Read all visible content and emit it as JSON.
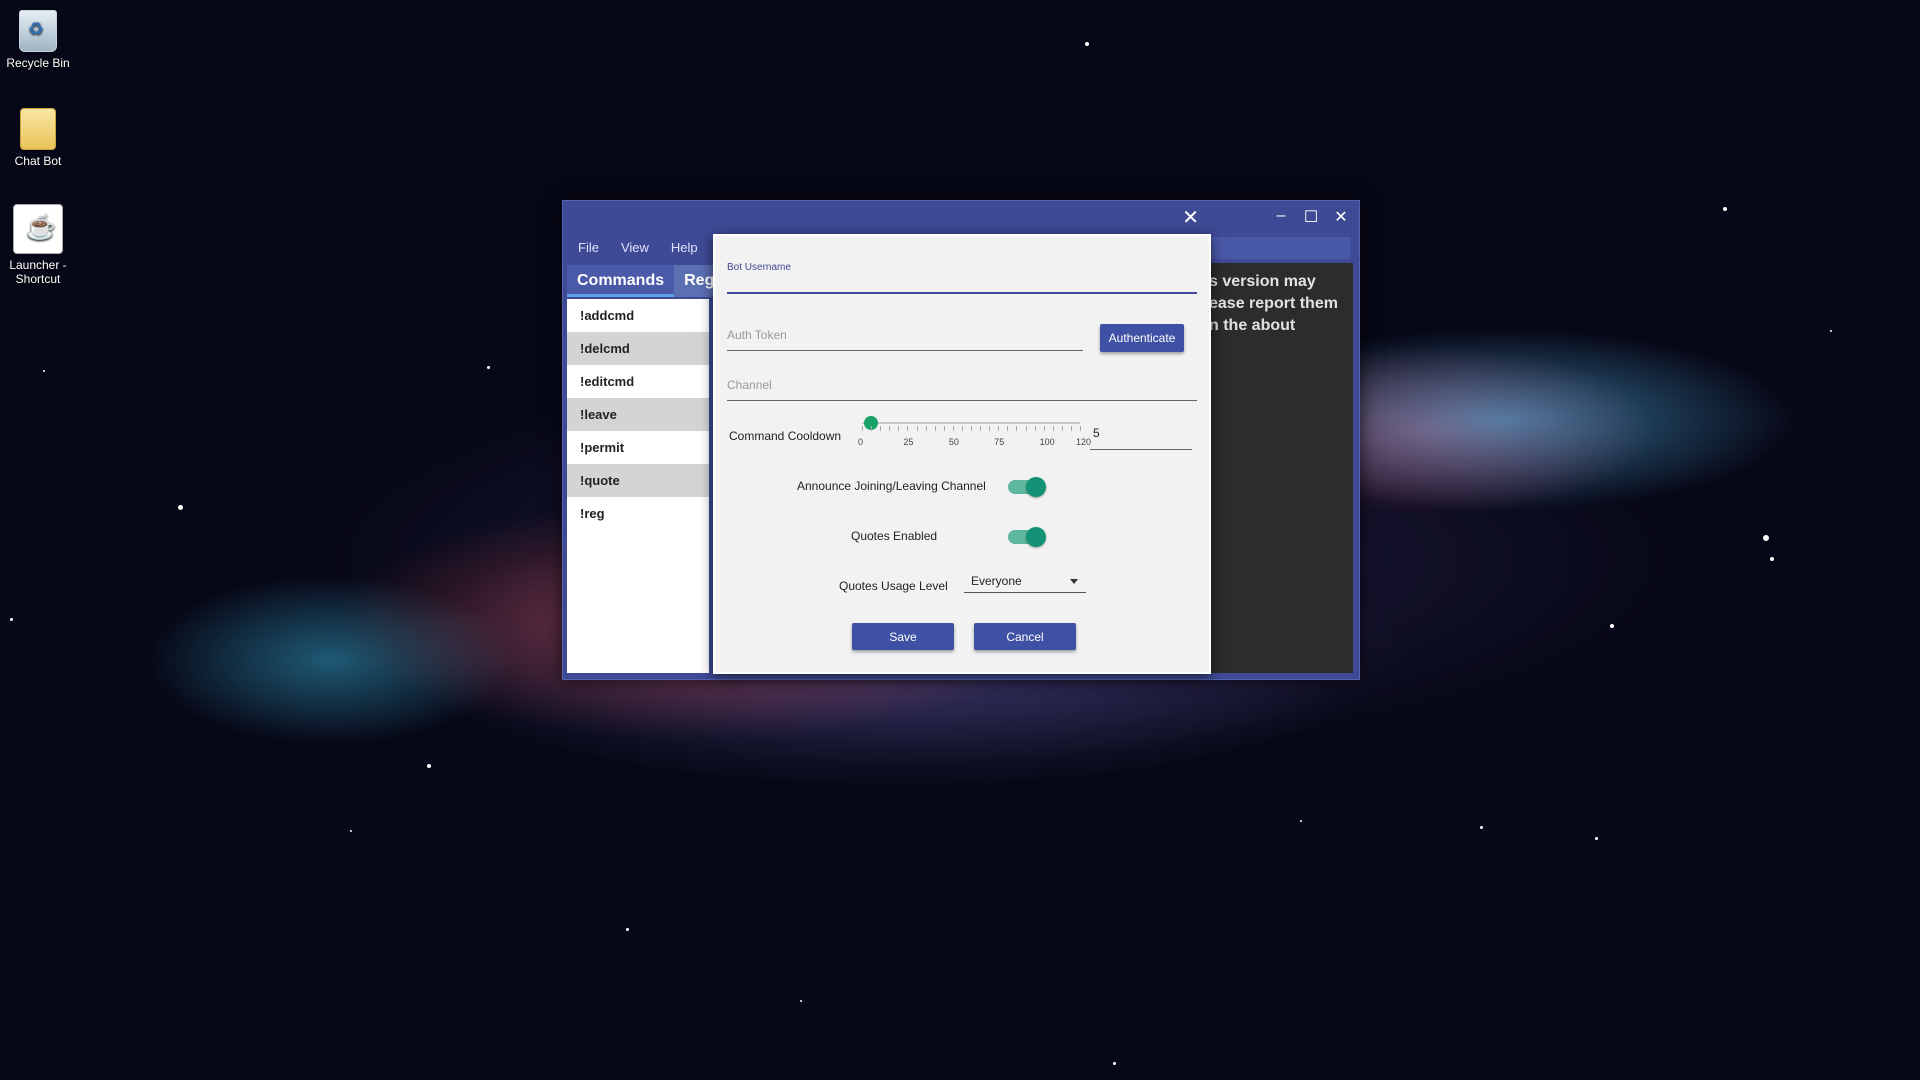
{
  "desktop": {
    "icons": [
      {
        "label": "Recycle Bin",
        "icon": "recycle-bin-icon"
      },
      {
        "label": "Chat Bot",
        "icon": "folder-icon"
      },
      {
        "label": "Launcher - Shortcut",
        "icon": "java-icon"
      }
    ]
  },
  "window": {
    "menu": [
      "File",
      "View",
      "Help"
    ],
    "tabs": [
      "Commands",
      "Reg"
    ],
    "commands": [
      "!addcmd",
      "!delcmd",
      "!editcmd",
      "!leave",
      "!permit",
      "!quote",
      "!reg"
    ],
    "notice_lines": [
      "s version may",
      "ease report them",
      "n the about"
    ],
    "controls": {
      "minimize": "–",
      "maximize": "☐",
      "close": "✕"
    }
  },
  "dialog": {
    "close": "✕",
    "bot_username_label": "Bot Username",
    "auth_token_placeholder": "Auth Token",
    "authenticate": "Authenticate",
    "channel_placeholder": "Channel",
    "command_cooldown_label": "Command Cooldown",
    "slider": {
      "min": 0,
      "max": 120,
      "value": 5,
      "tick_labels": [
        "0",
        "25",
        "50",
        "75",
        "100",
        "120"
      ]
    },
    "cooldown_value": "5",
    "announce_label": "Announce Joining/Leaving Channel",
    "announce_on": true,
    "quotes_enabled_label": "Quotes Enabled",
    "quotes_enabled_on": true,
    "quotes_usage_label": "Quotes Usage Level",
    "quotes_usage_value": "Everyone",
    "save": "Save",
    "cancel": "Cancel"
  },
  "colors": {
    "accent": "#3f51a4",
    "toggle": "#149275",
    "slider": "#1aa26a"
  }
}
